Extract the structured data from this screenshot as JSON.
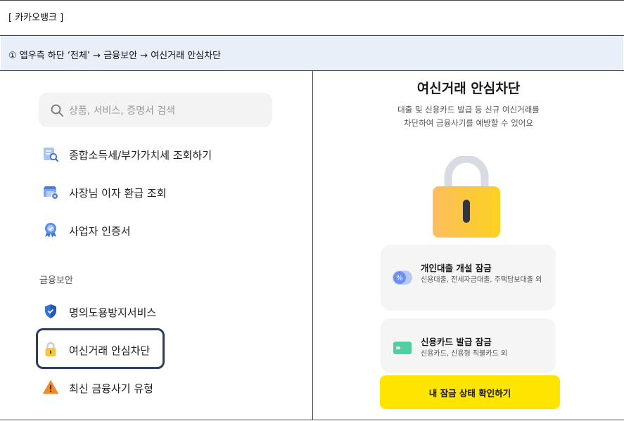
{
  "doc": {
    "title": "[ 카카오뱅크 ]",
    "step": "① 앱우측 하단 ‘전체’ → 금융보안 → 여신거래 안심차단"
  },
  "left": {
    "search_placeholder": "상품, 서비스, 증명서 검색",
    "menu_items": [
      {
        "label": "종합소득세/부가가치세 조회하기",
        "icon": "tax-document-search-icon"
      },
      {
        "label": "사장님 이자 환급 조회",
        "icon": "store-refund-icon"
      },
      {
        "label": "사업자 인증서",
        "icon": "certificate-badge-icon"
      }
    ],
    "section_label": "금융보안",
    "security_items": [
      {
        "label": "명의도용방지서비스",
        "icon": "shield-check-icon"
      },
      {
        "label": "여신거래 안심차단",
        "icon": "padlock-icon"
      },
      {
        "label": "최신 금융사기 유형",
        "icon": "warning-icon"
      }
    ]
  },
  "right": {
    "title": "여신거래 안심차단",
    "desc_line1": "대출 및 신용카드 발급 등 신규 여신거래를",
    "desc_line2": "차단하여 금융사기를 예방할 수 있어요",
    "cards": [
      {
        "title": "개인대출 개설 잠금",
        "desc": "신용대출, 전세자금대출, 주택담보대출 외",
        "icon": "loan-toggle-icon"
      },
      {
        "title": "신용카드 발급 잠금",
        "desc": "신용카드, 신용형 직불카드 외",
        "icon": "credit-card-icon"
      }
    ],
    "button_label": "내 잠금 상태 확인하기"
  },
  "colors": {
    "accent_yellow": "#fee500",
    "highlight_border": "#2d3e63",
    "step_row_bg": "#e9eff8",
    "lock_body": "#fccb3a",
    "lock_shackle": "#d8dbe3"
  }
}
